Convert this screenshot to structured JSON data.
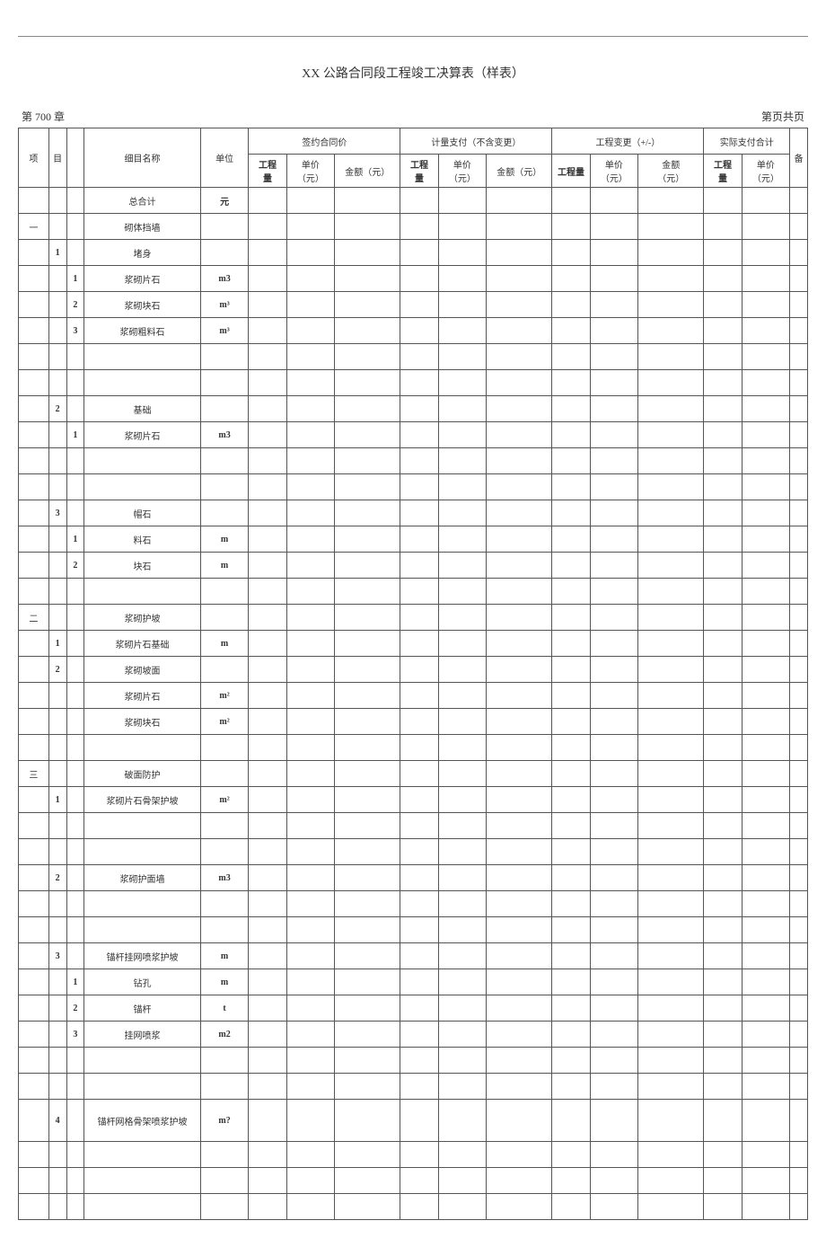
{
  "title": "XX 公路合同段工程竣工决算表（样表）",
  "meta": {
    "left": "第 700 章",
    "right": "第页共页"
  },
  "headers": {
    "xiang": "项",
    "mu": "目",
    "name": "细目名称",
    "unit": "单位",
    "g1": "签约合同价",
    "g2": "计量支付（不含变更）",
    "g3": "工程变更（+/-）",
    "g4": "实际支付合计",
    "qty": "工程量",
    "qty2": "工程",
    "qty2b": "量",
    "price": "单价（元）",
    "price2": "单价",
    "price2b": "（元）",
    "amt": "金额（元）",
    "amt2": "金额",
    "amt2b": "（元）",
    "bei": "备"
  },
  "rows": [
    {
      "c1": "",
      "c2": "",
      "c3": "",
      "name": "总合计",
      "unit": "元"
    },
    {
      "c1": "一",
      "c2": "",
      "c3": "",
      "name": "砌体挡墙",
      "unit": ""
    },
    {
      "c1": "",
      "c2": "1",
      "c3": "",
      "name": "堵身",
      "unit": ""
    },
    {
      "c1": "",
      "c2": "",
      "c3": "1",
      "name": "浆砌片石",
      "unit": "m3"
    },
    {
      "c1": "",
      "c2": "",
      "c3": "2",
      "name": "浆砌块石",
      "unit": "m³"
    },
    {
      "c1": "",
      "c2": "",
      "c3": "3",
      "name": "浆砌粗料石",
      "unit": "m³"
    },
    {
      "c1": "",
      "c2": "",
      "c3": "",
      "name": "",
      "unit": ""
    },
    {
      "c1": "",
      "c2": "",
      "c3": "",
      "name": "",
      "unit": ""
    },
    {
      "c1": "",
      "c2": "2",
      "c3": "",
      "name": "基础",
      "unit": ""
    },
    {
      "c1": "",
      "c2": "",
      "c3": "1",
      "name": "浆砌片石",
      "unit": "m3"
    },
    {
      "c1": "",
      "c2": "",
      "c3": "",
      "name": "",
      "unit": ""
    },
    {
      "c1": "",
      "c2": "",
      "c3": "",
      "name": "",
      "unit": ""
    },
    {
      "c1": "",
      "c2": "3",
      "c3": "",
      "name": "帽石",
      "unit": ""
    },
    {
      "c1": "",
      "c2": "",
      "c3": "1",
      "name": "料石",
      "unit": "m"
    },
    {
      "c1": "",
      "c2": "",
      "c3": "2",
      "name": "块石",
      "unit": "m"
    },
    {
      "c1": "",
      "c2": "",
      "c3": "",
      "name": "",
      "unit": ""
    },
    {
      "c1": "二",
      "c2": "",
      "c3": "",
      "name": "浆砌护坡",
      "unit": ""
    },
    {
      "c1": "",
      "c2": "1",
      "c3": "",
      "name": "浆砌片石基础",
      "unit": "m"
    },
    {
      "c1": "",
      "c2": "2",
      "c3": "",
      "name": "浆砌坡面",
      "unit": ""
    },
    {
      "c1": "",
      "c2": "",
      "c3": "",
      "name": "浆砌片石",
      "unit": "m²"
    },
    {
      "c1": "",
      "c2": "",
      "c3": "",
      "name": "浆砌块石",
      "unit": "m²"
    },
    {
      "c1": "",
      "c2": "",
      "c3": "",
      "name": "",
      "unit": ""
    },
    {
      "c1": "三",
      "c2": "",
      "c3": "",
      "name": "破面防护",
      "unit": ""
    },
    {
      "c1": "",
      "c2": "1",
      "c3": "",
      "name": "浆砌片石骨架护坡",
      "unit": "m²"
    },
    {
      "c1": "",
      "c2": "",
      "c3": "",
      "name": "",
      "unit": ""
    },
    {
      "c1": "",
      "c2": "",
      "c3": "",
      "name": "",
      "unit": ""
    },
    {
      "c1": "",
      "c2": "2",
      "c3": "",
      "name": "浆砌护面墙",
      "unit": "m3"
    },
    {
      "c1": "",
      "c2": "",
      "c3": "",
      "name": "",
      "unit": ""
    },
    {
      "c1": "",
      "c2": "",
      "c3": "",
      "name": "",
      "unit": ""
    },
    {
      "c1": "",
      "c2": "3",
      "c3": "",
      "name": "锚杆挂网喷浆护坡",
      "unit": "m"
    },
    {
      "c1": "",
      "c2": "",
      "c3": "1",
      "name": "钻孔",
      "unit": "m"
    },
    {
      "c1": "",
      "c2": "",
      "c3": "2",
      "name": "锚杆",
      "unit": "t"
    },
    {
      "c1": "",
      "c2": "",
      "c3": "3",
      "name": "挂网喷浆",
      "unit": "m2"
    },
    {
      "c1": "",
      "c2": "",
      "c3": "",
      "name": "",
      "unit": ""
    },
    {
      "c1": "",
      "c2": "",
      "c3": "",
      "name": "",
      "unit": ""
    },
    {
      "c1": "",
      "c2": "4",
      "c3": "",
      "name": "锚杆网格骨架喷浆护坡",
      "unit": "m?",
      "tall": true
    },
    {
      "c1": "",
      "c2": "",
      "c3": "",
      "name": "",
      "unit": ""
    },
    {
      "c1": "",
      "c2": "",
      "c3": "",
      "name": "",
      "unit": ""
    },
    {
      "c1": "",
      "c2": "",
      "c3": "",
      "name": "",
      "unit": ""
    }
  ]
}
